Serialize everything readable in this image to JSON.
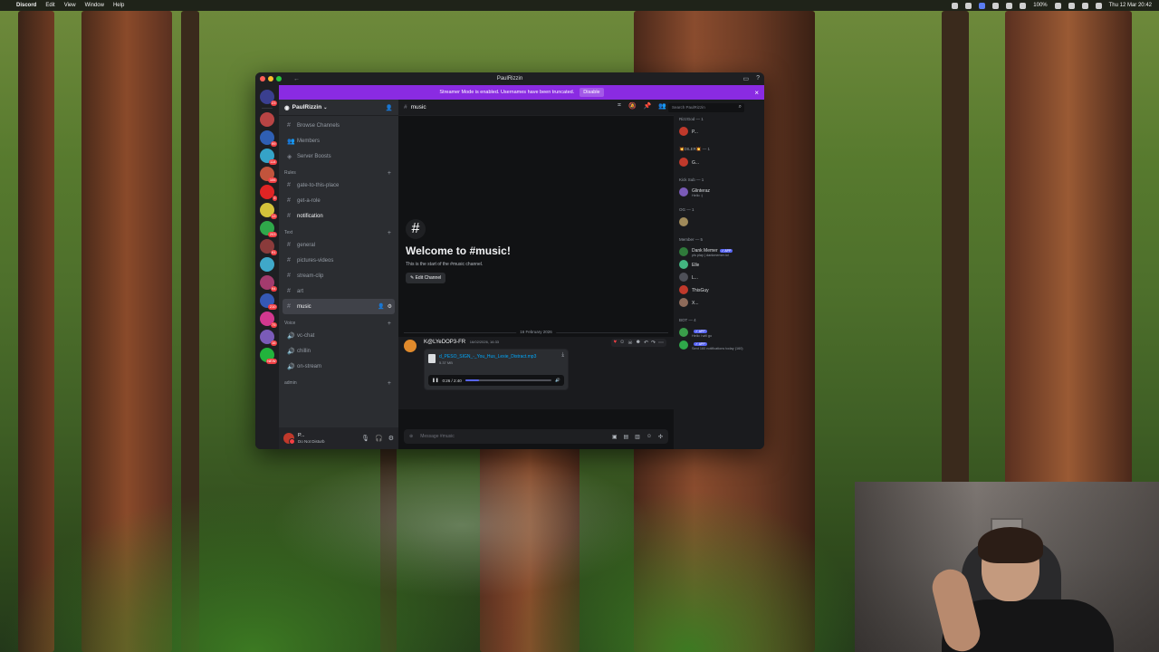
{
  "menubar": {
    "apple": "",
    "app": "Discord",
    "items": [
      "Edit",
      "View",
      "Window",
      "Help"
    ],
    "battery": "100%",
    "datetime": "Thu 12 Mar 20:42"
  },
  "window": {
    "title": "PaulRizzin",
    "back_icon": "arrow-left-icon",
    "banner": {
      "text": "Streamer Mode is enabled. Usernames have been truncated.",
      "button": "Disable",
      "close": "×"
    }
  },
  "servers": [
    {
      "color": "#3a3f8f",
      "badge": "23"
    },
    {
      "color": "#b84444",
      "badge": ""
    },
    {
      "color": "#2f5fb3",
      "badge": "99"
    },
    {
      "color": "#35a3c7",
      "badge": "114"
    },
    {
      "color": "#c2543c",
      "badge": "106"
    },
    {
      "color": "#e02424",
      "badge": "9"
    },
    {
      "color": "#d4c23a",
      "badge": "13"
    },
    {
      "color": "#2fa84a",
      "badge": "203"
    },
    {
      "color": "#8a3b3b",
      "badge": "91"
    },
    {
      "color": "#3fa8c9",
      "badge": ""
    },
    {
      "color": "#a33b6e",
      "badge": "94"
    },
    {
      "color": "#3558b5",
      "badge": "210"
    },
    {
      "color": "#d2388f",
      "badge": "75"
    },
    {
      "color": "#7a5bb8",
      "badge": "16"
    },
    {
      "color": "#22b33c",
      "badge": "NEW"
    }
  ],
  "sidebar": {
    "server_name": "PaulRizzin",
    "top_items": [
      {
        "icon": "#",
        "label": "Browse Channels"
      },
      {
        "icon": "👥",
        "label": "Members"
      },
      {
        "icon": "◈",
        "label": "Server Boosts"
      }
    ],
    "categories": [
      {
        "name": "Rules",
        "channels": [
          {
            "label": "gate-to-this-place",
            "style": ""
          },
          {
            "label": "get-a-role",
            "style": ""
          },
          {
            "label": "notification",
            "style": "bold"
          }
        ]
      },
      {
        "name": "Text",
        "channels": [
          {
            "label": "general",
            "style": ""
          },
          {
            "label": "pictures-videos",
            "style": ""
          },
          {
            "label": "stream-clip",
            "style": ""
          },
          {
            "label": "art",
            "style": ""
          },
          {
            "label": "music",
            "style": "active"
          }
        ]
      },
      {
        "name": "Voice",
        "channels": [
          {
            "label": "vc-chat",
            "style": ""
          },
          {
            "label": "chillin",
            "style": ""
          },
          {
            "label": "on-stream",
            "style": ""
          }
        ]
      },
      {
        "name": "admin",
        "channels": []
      }
    ],
    "user": {
      "name": "P...",
      "status": "Do Not Disturb"
    }
  },
  "main": {
    "channel": "music",
    "welcome_title": "Welcome to #music!",
    "welcome_sub": "This is the start of the #music channel.",
    "edit_channel": "Edit Channel",
    "date_divider": "16 February 2026",
    "message": {
      "author": "K@LYeDOP3-FR",
      "timestamp": "16/02/2026, 16:33",
      "file_name": "d_PESO_SIGN_-_You_Hus_Lexie_Distract.mp3",
      "file_size": "5.37 MB",
      "time": "0:26 / 2:40",
      "progress": 0.16
    },
    "composer_placeholder": "Message #music"
  },
  "members": {
    "search_placeholder": "Search PaulRizzin",
    "groups": [
      {
        "role": "RizzGod — 1",
        "members": [
          {
            "name": "P...",
            "status": "",
            "color": "#c0392b",
            "app": ""
          }
        ]
      },
      {
        "role": "💥DILER💥 — 1",
        "members": [
          {
            "name": "G...",
            "status": "",
            "color": "#c0392b",
            "app": ""
          }
        ]
      },
      {
        "role": "Kick Sub — 1",
        "members": [
          {
            "name": "Glinteraz",
            "status": "Hello :)",
            "color": "#7a5bb8",
            "app": ""
          }
        ]
      },
      {
        "role": "OG — 1",
        "members": [
          {
            "name": "",
            "status": "",
            "color": "#a08a5a",
            "app": ""
          }
        ]
      },
      {
        "role": "Member — 5",
        "members": [
          {
            "name": "Dank Memer",
            "status": "pls play | dankmemer.lol",
            "color": "#2f7a3a",
            "app": "✓ APP"
          },
          {
            "name": "Elle",
            "status": "",
            "color": "#43b581",
            "app": ""
          },
          {
            "name": "L...",
            "status": "",
            "color": "#4e5058",
            "app": ""
          },
          {
            "name": "ThisGuy",
            "status": "",
            "color": "#c0392b",
            "app": ""
          },
          {
            "name": "X...",
            "status": "",
            "color": "#8e6b5a",
            "app": ""
          }
        ]
      },
      {
        "role": "BOT — 4",
        "members": [
          {
            "name": "",
            "status": "Hello i will go",
            "color": "#3a9c4a",
            "app": "✓ APP"
          },
          {
            "name": "",
            "status": "Sent 160 notifications today (160)",
            "color": "#2fa84a",
            "app": "✓ APP"
          }
        ]
      }
    ]
  }
}
